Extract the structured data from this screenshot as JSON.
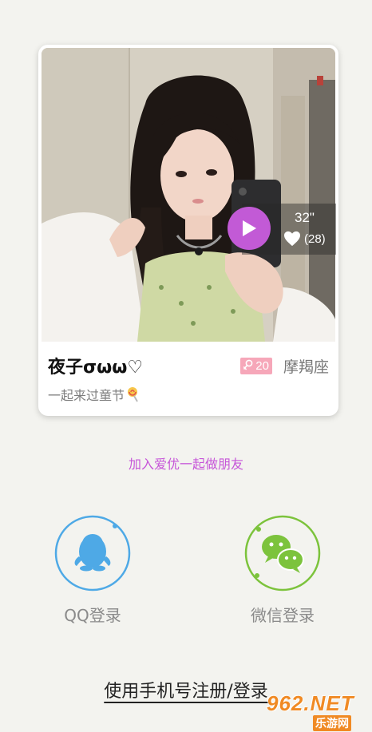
{
  "card": {
    "video": {
      "duration": "32\"",
      "likes": "(28)"
    },
    "nickname": "夜子σωω♡",
    "age": "20",
    "zodiac": "摩羯座",
    "signature": "一起来过童节"
  },
  "tagline": "加入爱优一起做朋友",
  "login": {
    "qq_label": "QQ登录",
    "wechat_label": "微信登录",
    "phone_label": "使用手机号注册/登录"
  },
  "watermark": {
    "brand": "962.NET",
    "sub": "乐游网"
  },
  "colors": {
    "accent_purple": "#c25ad6",
    "qq_blue": "#4ea9e6",
    "wechat_green": "#7cc33c",
    "age_badge_pink": "#f6a7b9"
  }
}
